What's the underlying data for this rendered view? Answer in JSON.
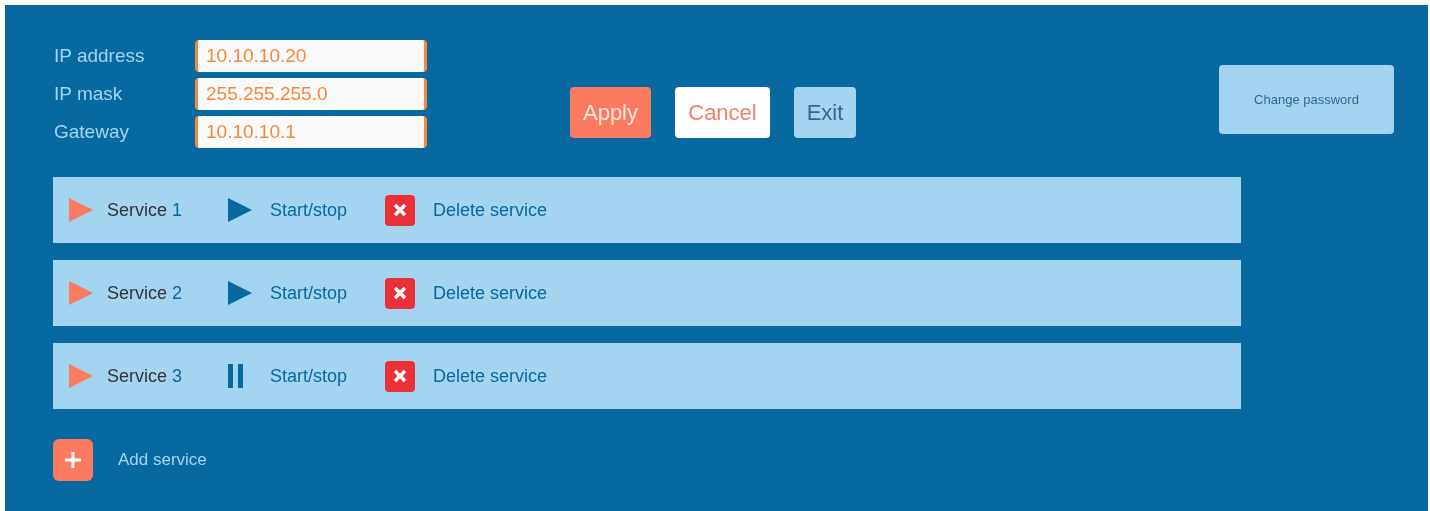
{
  "network": [
    {
      "label": "IP address",
      "value": "10.10.10.20"
    },
    {
      "label": "IP mask",
      "value": "255.255.255.0"
    },
    {
      "label": "Gateway",
      "value": "10.10.10.1"
    }
  ],
  "buttons": [
    {
      "kind": "primary",
      "label": "Apply"
    },
    {
      "kind": "secondary",
      "label": "Cancel"
    },
    {
      "kind": "plain",
      "label": "Exit"
    }
  ],
  "change_password": "Change password",
  "services": [
    {
      "name": "Service",
      "number": "1",
      "running": false,
      "toggle": "Start/stop",
      "delete": "Delete service"
    },
    {
      "name": "Service",
      "number": "2",
      "running": false,
      "toggle": "Start/stop",
      "delete": "Delete service"
    },
    {
      "name": "Service",
      "number": "3",
      "running": true,
      "toggle": "Start/stop",
      "delete": "Delete service"
    }
  ],
  "add_service": "Add service"
}
